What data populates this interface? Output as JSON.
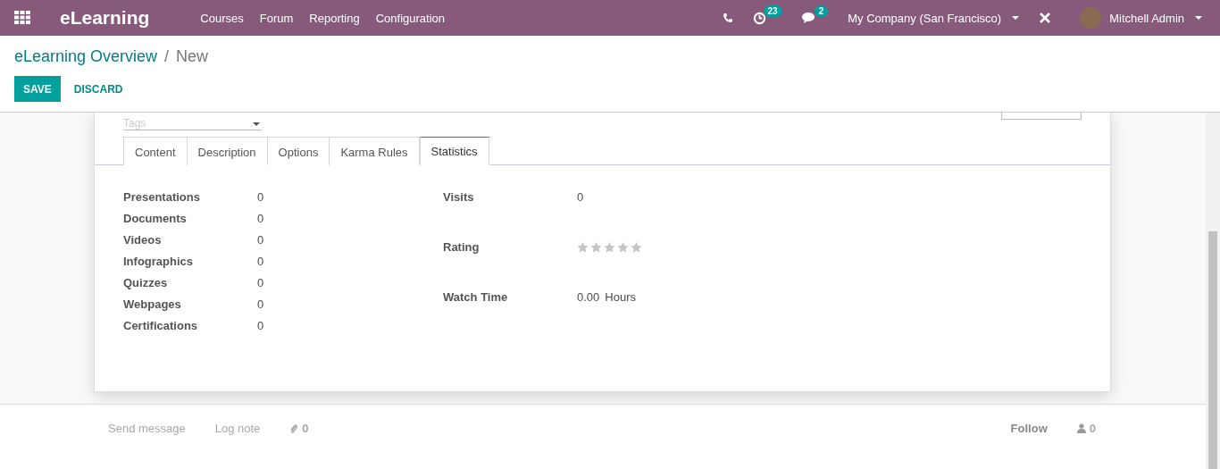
{
  "navbar": {
    "app_name": "eLearning",
    "menu": [
      "Courses",
      "Forum",
      "Reporting",
      "Configuration"
    ],
    "activity_count": "23",
    "message_count": "2",
    "company": "My Company (San Francisco)",
    "user": "Mitchell Admin"
  },
  "breadcrumb": {
    "parent": "eLearning Overview",
    "separator": "/",
    "current": "New"
  },
  "actions": {
    "save": "SAVE",
    "discard": "DISCARD"
  },
  "form": {
    "tags": {
      "placeholder": "Tags"
    },
    "tabs": [
      {
        "label": "Content",
        "selected": false
      },
      {
        "label": "Description",
        "selected": false
      },
      {
        "label": "Options",
        "selected": false
      },
      {
        "label": "Karma Rules",
        "selected": false
      },
      {
        "label": "Statistics",
        "selected": true
      }
    ],
    "left_stats": [
      {
        "label": "Presentations",
        "value": "0"
      },
      {
        "label": "Documents",
        "value": "0"
      },
      {
        "label": "Videos",
        "value": "0"
      },
      {
        "label": "Infographics",
        "value": "0"
      },
      {
        "label": "Quizzes",
        "value": "0"
      },
      {
        "label": "Webpages",
        "value": "0"
      },
      {
        "label": "Certifications",
        "value": "0"
      }
    ],
    "visits": {
      "label": "Visits",
      "value": "0"
    },
    "rating": {
      "label": "Rating",
      "stars": 0
    },
    "watch_time": {
      "label": "Watch Time",
      "value": "0.00",
      "unit": "Hours"
    }
  },
  "chatter": {
    "send_message": "Send message",
    "log_note": "Log note",
    "attachments": "0",
    "follow": "Follow",
    "followers": "0"
  }
}
